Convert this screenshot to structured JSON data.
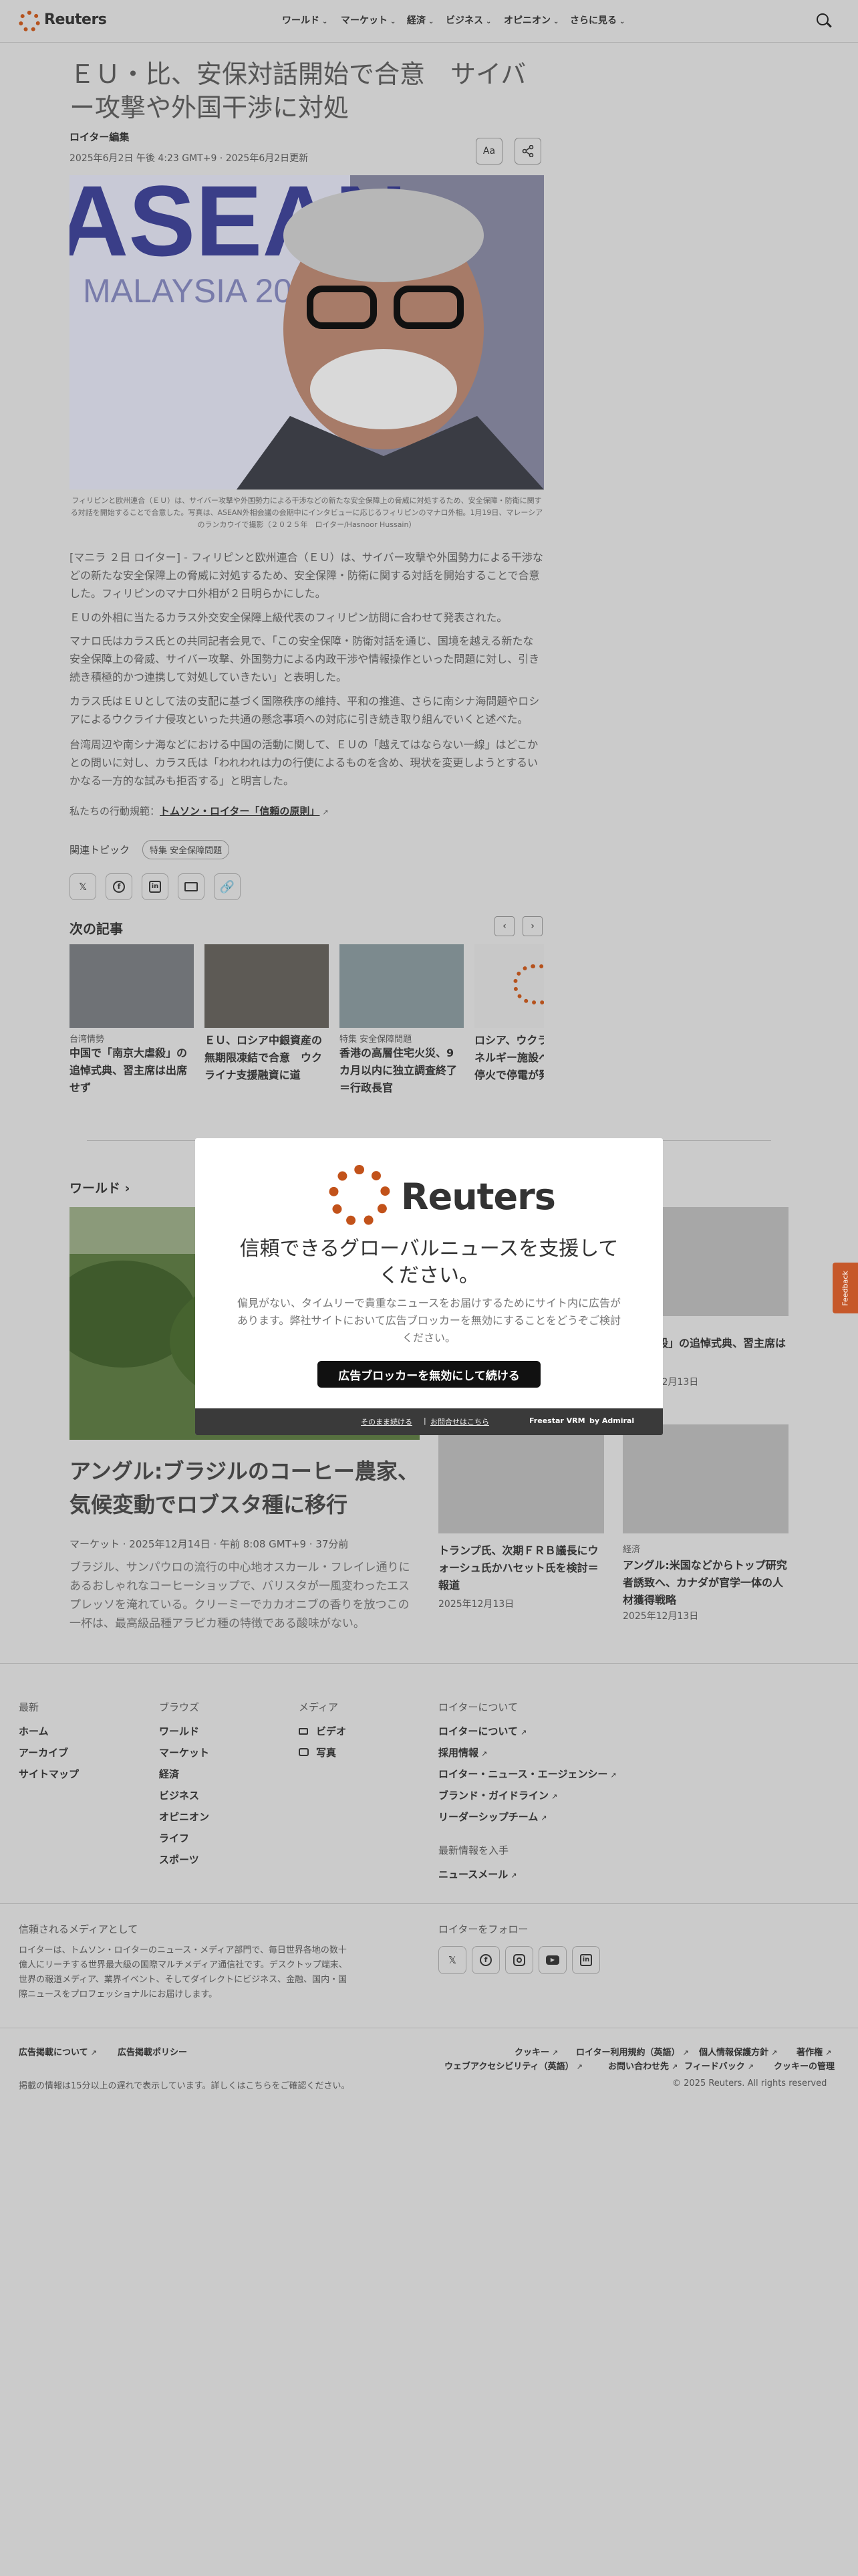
{
  "header": {
    "logo": "Reuters",
    "nav": [
      {
        "label": "ワールド"
      },
      {
        "label": "マーケット"
      },
      {
        "label": "経済"
      },
      {
        "label": "ビジネス"
      },
      {
        "label": "オピニオン"
      },
      {
        "label": "さらに見る"
      }
    ],
    "search_icon": "search-icon"
  },
  "article": {
    "title": "ＥＵ・比、安保対話開始で合意　サイバー攻撃や外国干渉に対処",
    "byline": "ロイター編集",
    "date": "2025年6月2日 午後 4:23 GMT+9 · 2025年6月2日更新",
    "font_btn": "Aa",
    "caption": "フィリピンと欧州連合（ＥＵ）は、サイバー攻撃や外国勢力による干渉などの新たな安全保障上の脅威に対処するため、安全保障・防衛に関する対話を開始することで合意した。写真は、ASEAN外相会議の会期中にインタビューに応じるフィリピンのマナロ外相。1月19日、マレーシアのランカウイで撮影（２０２５年　ロイター/Hasnoor Hussain）",
    "paragraphs": [
      "[マニラ ２日 ロイター] - フィリピンと欧州連合（ＥＵ）は、サイバー攻撃や外国勢力による干渉などの新たな安全保障上の脅威に対処するため、安全保障・防衛に関する対話を開始することで合意した。フィリピンのマナロ外相が２日明らかにした。",
      "ＥＵの外相に当たるカラス外交安全保障上級代表のフィリピン訪問に合わせて発表された。",
      "マナロ氏はカラス氏との共同記者会見で、「この安全保障・防衛対話を通じ、国境を越える新たな安全保障上の脅威、サイバー攻撃、外国勢力による内政干渉や情報操作といった問題に対し、引き続き積極的かつ連携して対処していきたい」と表明した。",
      "カラス氏はＥＵとして法の支配に基づく国際秩序の維持、平和の推進、さらに南シナ海問題やロシアによるウクライナ侵攻といった共通の懸念事項への対応に引き続き取り組んでいくと述べた。",
      "台湾周辺や南シナ海などにおける中国の活動に関して、ＥＵの「越えてはならない一線」はどこかとの問いに対し、カラス氏は「われわれは力の行使によるものを含め、現状を変更しようとするいかなる一方的な試みも拒否する」と明言した。"
    ],
    "principles_prefix": "私たちの行動規範：",
    "principles_link": "トムソン・ロイター「信頼の原則」",
    "topics_label": "関連トピック",
    "topic_pill": "特集 安全保障問題",
    "share_icons": [
      "x-icon",
      "facebook-icon",
      "linkedin-icon",
      "email-icon",
      "link-icon"
    ]
  },
  "next": {
    "heading": "次の記事",
    "prev": "‹",
    "next": "›",
    "cards": [
      {
        "tag": "台湾情勢",
        "title": "中国で「南京大虐殺」の追悼式典、習主席は出席せず"
      },
      {
        "tag": "",
        "title": "ＥＵ、ロシア中銀資産の無期限凍結で合意　ウクライナ支援融資に道"
      },
      {
        "tag": "特集 安全保障問題",
        "title": "香港の高層住宅火災、9カ月以内に独立調査終了＝行政長官"
      },
      {
        "tag": "",
        "title": "ロシア、ウクライナのエネルギー施設への攻撃、停火で停電が発生"
      }
    ]
  },
  "world": {
    "heading": "ワールド ›",
    "main": {
      "title": "アングル:ブラジルのコーヒー農家、気候変動でロブスタ種に移行",
      "meta": "マーケット · 2025年12月14日 · 午前 8:08 GMT+9 · 37分前",
      "desc": "ブラジル、サンパウロの流行の中心地オスカール・フレイレ通りにあるおしゃれなコーヒーショップで、バリスタが一風変わったエスプレッソを淹れている。クリーミーでカカオニブの香りを放つこの一杯は、最高級品種アラビカ種の特徴である酸味がない。"
    },
    "side": [
      {
        "title": "中国で「南京大虐殺」の追悼式典、習主席は出席せず",
        "tag": "",
        "date": "2025年12月13日"
      },
      {
        "title": "トランプ氏、次期ＦＲＢ議長にウォーシュ氏かハセット氏を検討＝報道",
        "tag": "",
        "date": "2025年12月13日"
      },
      {
        "title": "アングル:米国などからトップ研究者誘致へ、カナダが官学一体の人材獲得戦略",
        "tag": "経済",
        "date": "2025年12月13日"
      }
    ]
  },
  "modal": {
    "logo": "Reuters",
    "heading": "信頼できるグローバルニュースを支援してください。",
    "body": "偏見がない、タイムリーで貴重なニュースをお届けするためにサイト内に広告があります。弊社サイトにおいて広告ブロッカーを無効にすることをどうぞご検討ください。",
    "button": "広告ブロッカーを無効にして続ける",
    "continue_link": "そのまま続ける",
    "contact_link": "お問合せはこちら",
    "credit": "Freestar VRM",
    "credit2": "by Admiral"
  },
  "feedback": "Feedback",
  "footer": {
    "col1": {
      "heading": "最新",
      "links": [
        "ホーム",
        "アーカイブ",
        "サイトマップ"
      ]
    },
    "col2": {
      "heading": "ブラウズ",
      "links": [
        "ワールド",
        "マーケット",
        "経済",
        "ビジネス",
        "オピニオン",
        "ライフ",
        "スポーツ"
      ]
    },
    "col3": {
      "heading": "メディア",
      "links": [
        "ビデオ",
        "写真"
      ]
    },
    "col4": {
      "heading": "ロイターについて",
      "links": [
        "ロイターについて",
        "採用情報",
        "ロイター・ニュース・エージェンシー",
        "ブランド・ガイドライン",
        "リーダーシップチーム"
      ]
    },
    "newsletter_heading": "最新情報を入手",
    "newsletter_link": "ニュースメール",
    "trusted_heading": "信頼されるメディアとして",
    "trusted_body": "ロイターは、トムソン・ロイターのニュース・メディア部門で、毎日世界各地の数十億人にリーチする世界最大級の国際マルチメディア通信社です。デスクトップ端末、世界の報道メディア、業界イベント、そしてダイレクトにビジネス、金融、国内・国際ニュースをプロフェッショナルにお届けします。",
    "follow_heading": "ロイターをフォロー",
    "social_icons": [
      "x-icon",
      "facebook-icon",
      "instagram-icon",
      "youtube-icon",
      "linkedin-icon"
    ],
    "ad_links": [
      "広告掲載について",
      "広告掲載ポリシー"
    ],
    "legal_row1": [
      "クッキー",
      "ロイター利用規約（英語）",
      "個人情報保護方針",
      "著作権"
    ],
    "legal_row2": [
      "ウェブアクセシビリティ（英語）",
      "お問い合わせ先",
      "フィードバック",
      "クッキーの管理"
    ],
    "disclaimer": "掲載の情報は15分以上の遅れで表示しています。詳しくはこちらをご確認ください。",
    "copyright": "© 2025 Reuters. All rights reserved"
  }
}
